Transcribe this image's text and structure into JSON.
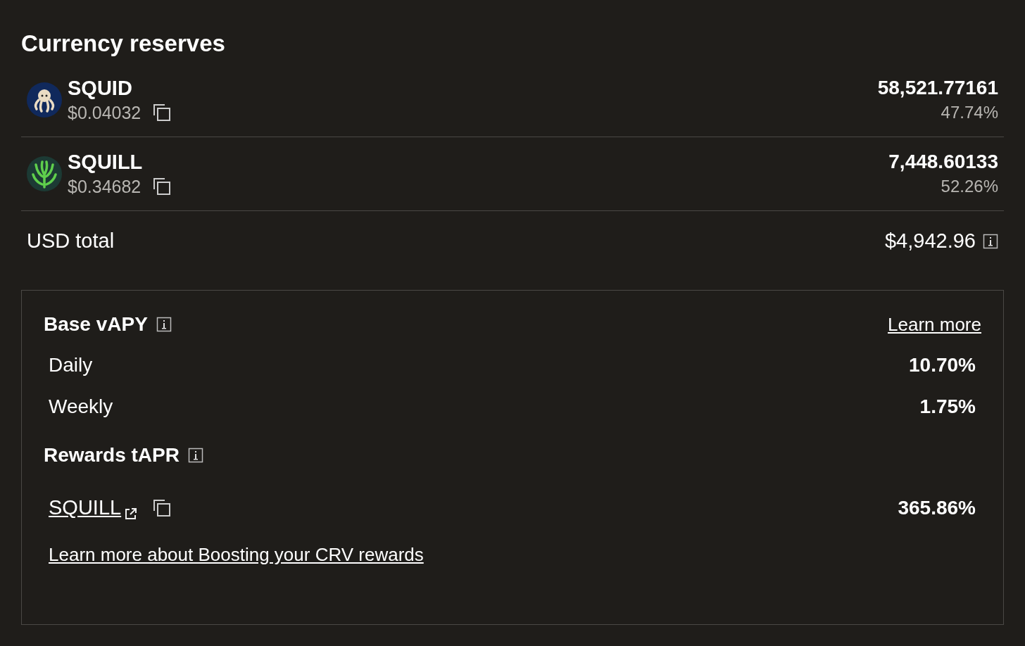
{
  "title": "Currency reserves",
  "reserves": [
    {
      "kind": "octopus",
      "symbol": "SQUID",
      "price": "$0.04032",
      "amount": "58,521.77161",
      "share": "47.74%"
    },
    {
      "kind": "tentacles",
      "symbol": "SQUILL",
      "price": "$0.34682",
      "amount": "7,448.60133",
      "share": "52.26%"
    }
  ],
  "usd_total": {
    "label": "USD total",
    "value": "$4,942.96"
  },
  "base_vapy": {
    "title": "Base vAPY",
    "link": "Learn more",
    "rows": [
      {
        "label": "Daily",
        "value": "10.70%"
      },
      {
        "label": "Weekly",
        "value": "1.75%"
      }
    ]
  },
  "rewards": {
    "title": "Rewards tAPR",
    "items": [
      {
        "token": "SQUILL",
        "value": "365.86%"
      }
    ]
  },
  "boost_link": "Learn more about Boosting your CRV rewards"
}
